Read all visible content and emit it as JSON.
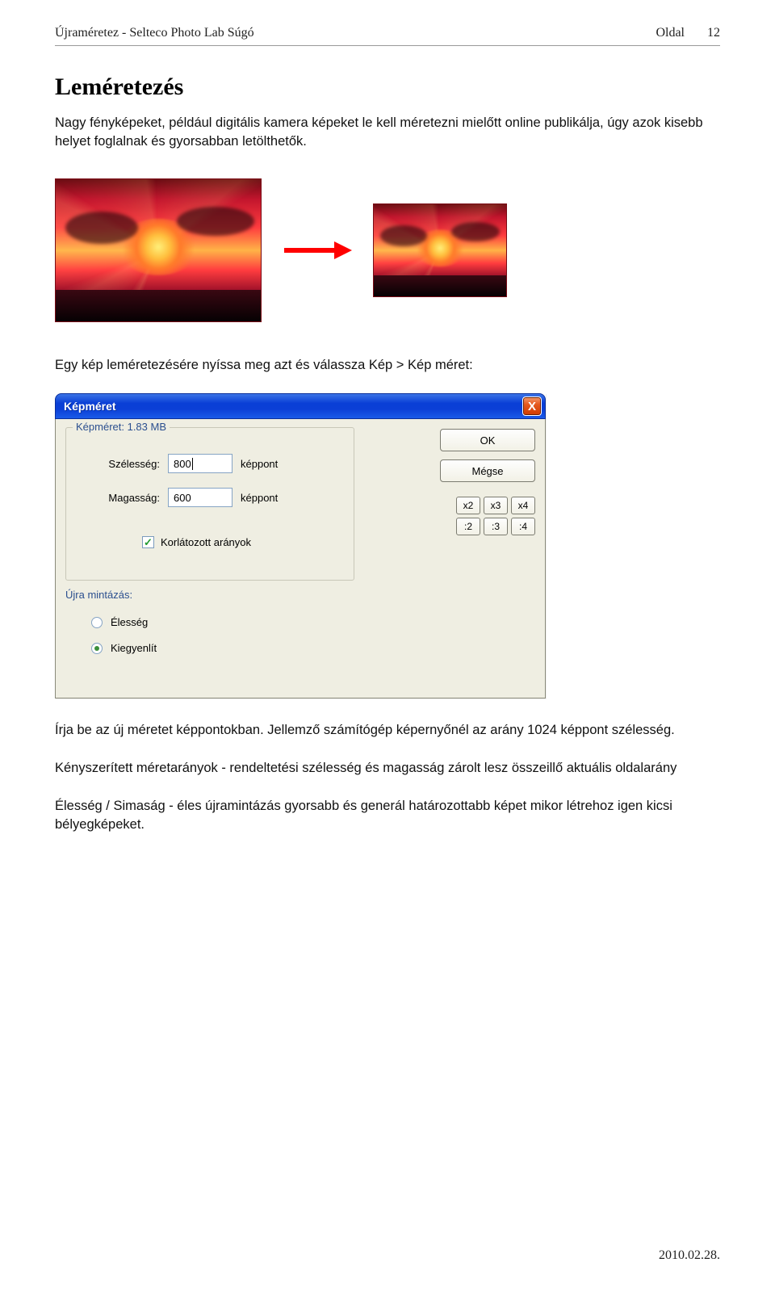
{
  "header": {
    "left": "Újraméretez - Selteco Photo Lab Súgó",
    "page_label": "Oldal",
    "page_number": "12"
  },
  "title": "Leméretezés",
  "paragraphs": {
    "intro": "Nagy fényképeket, például digitális kamera képeket le kell méretezni mielőtt online publikálja, úgy azok kisebb helyet foglalnak és gyorsabban letölthetők.",
    "open_instruction": "Egy kép leméretezésére nyíssa meg azt és válassza Kép > Kép méret:",
    "enter_new_size": "Írja be az új méretet képpontokban. Jellemző számítógép képernyőnél az arány 1024 képpont szélesség.",
    "forced_ratio": "Kényszerített méretarányok - rendeltetési szélesség és magasság zárolt lesz összeillő aktuális oldalarány",
    "sharpness": "Élesség / Simaság - éles újramintázás gyorsabb és generál határozottabb képet mikor létrehoz igen kicsi bélyegképeket."
  },
  "dialog": {
    "title": "Képméret",
    "close_symbol": "X",
    "size_legend": "Képméret: 1.83 MB",
    "width_label": "Szélesség:",
    "width_value": "800",
    "width_unit": "képpont",
    "height_label": "Magasság:",
    "height_value": "600",
    "height_unit": "képpont",
    "constrain_label": "Korlátozott arányok",
    "resample_label": "Újra mintázás:",
    "radio_sharp": "Élesség",
    "radio_smooth": "Kiegyenlít",
    "ok_label": "OK",
    "cancel_label": "Mégse",
    "scale_buttons": [
      "x2",
      "x3",
      "x4",
      ":2",
      ":3",
      ":4"
    ]
  },
  "footer": {
    "date": "2010.02.28."
  }
}
